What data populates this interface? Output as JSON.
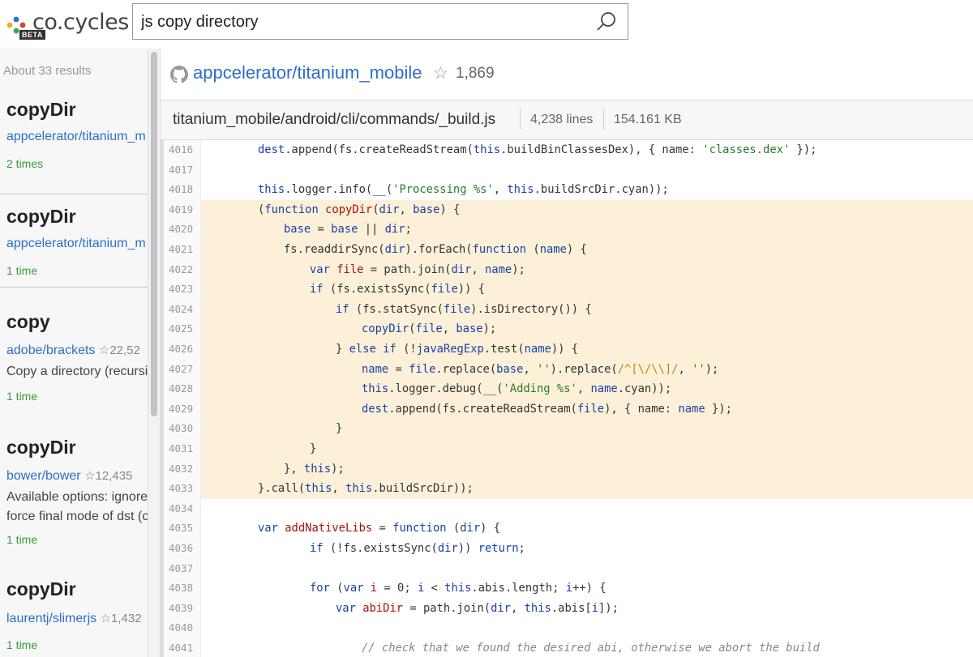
{
  "brand": {
    "name": "co.cycles",
    "badge": "BETA",
    "colors": {
      "dot_blue": "#2d6ec9",
      "dot_red": "#d9412b",
      "dot_green": "#3aa64a",
      "dot_yellow": "#e6b31e"
    }
  },
  "search": {
    "query": "js copy directory",
    "icon": "search-icon"
  },
  "sidebar": {
    "result_count": "About 33 results",
    "results": [
      {
        "title": "copyDir",
        "repo": "appcelerator/titanium_m",
        "stars": "",
        "desc": "",
        "desc2": "",
        "times": "2 times"
      },
      {
        "title": "copyDir",
        "repo": "appcelerator/titanium_m",
        "stars": "",
        "desc": "",
        "desc2": "",
        "times": "1 time"
      },
      {
        "title": "copy",
        "repo": "adobe/brackets",
        "stars": "22,52",
        "desc": "Copy a directory (recursi",
        "desc2": "",
        "times": "1 time"
      },
      {
        "title": "copyDir",
        "repo": "bower/bower",
        "stars": "12,435",
        "desc": "Available options: ignore",
        "desc2": "force final mode of dst (c",
        "times": "1 time"
      },
      {
        "title": "copyDir",
        "repo": "laurentj/slimerjs",
        "stars": "1,432",
        "desc": "",
        "desc2": "",
        "times": "1 time"
      }
    ]
  },
  "repo": {
    "name": "appcelerator/titanium_mobile",
    "stars": "1,869"
  },
  "file": {
    "path": "titanium_mobile/android/cli/commands/_build.js",
    "lines": "4,238 lines",
    "size": "154.161 KB"
  },
  "code": {
    "highlight_start": 4019,
    "highlight_end": 4033,
    "lines": [
      {
        "n": "4016",
        "indent": 0,
        "html": "<span class=\"var\">dest</span>.append(fs.createReadStream(<span class=\"kw\">this</span>.buildBinClassesDex), { name: <span class=\"str\">'classes.dex'</span> });"
      },
      {
        "n": "4017",
        "indent": 0,
        "html": ""
      },
      {
        "n": "4018",
        "indent": 0,
        "html": "<span class=\"kw\">this</span>.logger.info(__(<span class=\"str\">'Processing %s'</span>, <span class=\"kw\">this</span>.buildSrcDir.cyan));"
      },
      {
        "n": "4019",
        "indent": 0,
        "html": "(<span class=\"kw\">function</span> <span class=\"fn\">copyDir</span>(<span class=\"var\">dir</span>, <span class=\"var\">base</span>) {"
      },
      {
        "n": "4020",
        "indent": 1,
        "html": "<span class=\"var\">base</span> = <span class=\"var\">base</span> || <span class=\"var\">dir</span>;"
      },
      {
        "n": "4021",
        "indent": 1,
        "html": "fs.readdirSync(<span class=\"var\">dir</span>).forEach(<span class=\"kw\">function</span> (<span class=\"var\">name</span>) {"
      },
      {
        "n": "4022",
        "indent": 2,
        "html": "<span class=\"kw\">var</span> <span class=\"fn\">file</span> = path.join(<span class=\"var\">dir</span>, <span class=\"var\">name</span>);"
      },
      {
        "n": "4023",
        "indent": 2,
        "html": "<span class=\"kw\">if</span> (fs.existsSync(<span class=\"var\">file</span>)) {"
      },
      {
        "n": "4024",
        "indent": 3,
        "html": "<span class=\"kw\">if</span> (fs.statSync(<span class=\"var\">file</span>).isDirectory()) {"
      },
      {
        "n": "4025",
        "indent": 4,
        "html": "<span class=\"var\">copyDir</span>(<span class=\"var\">file</span>, <span class=\"var\">base</span>);"
      },
      {
        "n": "4026",
        "indent": 3,
        "html": "} <span class=\"kw\">else if</span> (!<span class=\"var\">javaRegExp</span>.test(<span class=\"var\">name</span>)) {"
      },
      {
        "n": "4027",
        "indent": 4,
        "html": "<span class=\"var\">name</span> = <span class=\"var\">file</span>.replace(<span class=\"var\">base</span>, <span class=\"str\">''</span>).replace(<span class=\"re\">/^[\\/\\\\]/</span>, <span class=\"str\">''</span>);"
      },
      {
        "n": "4028",
        "indent": 4,
        "html": "<span class=\"kw\">this</span>.logger.debug(__(<span class=\"str\">'Adding %s'</span>, <span class=\"var\">name</span>.cyan));"
      },
      {
        "n": "4029",
        "indent": 4,
        "html": "<span class=\"var\">dest</span>.append(fs.createReadStream(<span class=\"var\">file</span>), { name: <span class=\"var\">name</span> });"
      },
      {
        "n": "4030",
        "indent": 3,
        "html": "}"
      },
      {
        "n": "4031",
        "indent": 2,
        "html": "}"
      },
      {
        "n": "4032",
        "indent": 1,
        "html": "}, <span class=\"kw\">this</span>);"
      },
      {
        "n": "4033",
        "indent": 0,
        "html": "}.call(<span class=\"kw\">this</span>, <span class=\"kw\">this</span>.buildSrcDir));"
      },
      {
        "n": "4034",
        "indent": 0,
        "html": ""
      },
      {
        "n": "4035",
        "indent": 0,
        "html": "<span class=\"kw\">var</span> <span class=\"fn\">addNativeLibs</span> = <span class=\"kw\">function</span> (<span class=\"var\">dir</span>) {"
      },
      {
        "n": "4036",
        "indent": 2,
        "html": "<span class=\"kw\">if</span> (!fs.existsSync(<span class=\"var\">dir</span>)) <span class=\"kw\">return</span>;"
      },
      {
        "n": "4037",
        "indent": 0,
        "html": ""
      },
      {
        "n": "4038",
        "indent": 2,
        "html": "<span class=\"kw\">for</span> (<span class=\"kw\">var</span> <span class=\"fn\">i</span> = 0; <span class=\"var\">i</span> &lt; <span class=\"kw\">this</span>.abis.length; <span class=\"var\">i</span>++) {"
      },
      {
        "n": "4039",
        "indent": 3,
        "html": "<span class=\"kw\">var</span> <span class=\"fn\">abiDir</span> = path.join(<span class=\"var\">dir</span>, <span class=\"kw\">this</span>.abis[<span class=\"var\">i</span>]);"
      },
      {
        "n": "4040",
        "indent": 0,
        "html": ""
      },
      {
        "n": "4041",
        "indent": 4,
        "html": "<span class=\"cm\">// check that we found the desired abi, otherwise we abort the build</span>"
      }
    ]
  }
}
